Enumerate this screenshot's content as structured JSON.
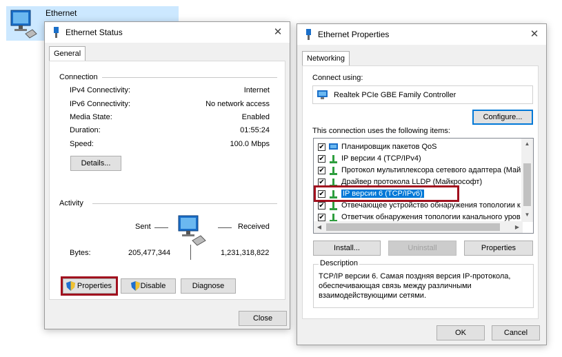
{
  "background": {
    "item_label": "Ethernet"
  },
  "status_window": {
    "title": "Ethernet Status",
    "tab": "General",
    "connection_label": "Connection",
    "rows": [
      {
        "label": "IPv4 Connectivity:",
        "value": "Internet"
      },
      {
        "label": "IPv6 Connectivity:",
        "value": "No network access"
      },
      {
        "label": "Media State:",
        "value": "Enabled"
      },
      {
        "label": "Duration:",
        "value": "01:55:24"
      },
      {
        "label": "Speed:",
        "value": "100.0 Mbps"
      }
    ],
    "details_button": "Details...",
    "activity_label": "Activity",
    "sent_label": "Sent",
    "received_label": "Received",
    "bytes_label": "Bytes:",
    "bytes_sent": "205,477,344",
    "bytes_received": "1,231,318,822",
    "properties_button": "Properties",
    "disable_button": "Disable",
    "diagnose_button": "Diagnose",
    "close_button": "Close"
  },
  "properties_window": {
    "title": "Ethernet Properties",
    "tab": "Networking",
    "connect_using_label": "Connect using:",
    "adapter_name": "Realtek PCIe GBE Family Controller",
    "configure_button": "Configure...",
    "items_label": "This connection uses the following items:",
    "items": [
      {
        "label": "Планировщик пакетов QoS",
        "checked": true,
        "icon": "qos-icon"
      },
      {
        "label": "IP версии 4 (TCP/IPv4)",
        "checked": true,
        "icon": "protocol-icon"
      },
      {
        "label": "Протокол мультиплексора сетевого адаптера (Май",
        "checked": true,
        "icon": "protocol-icon"
      },
      {
        "label": "Драйвер протокола LLDP (Майкрософт)",
        "checked": true,
        "icon": "protocol-icon"
      },
      {
        "label": "IP версии 6 (TCP/IPv6)",
        "checked": true,
        "icon": "protocol-icon",
        "selected": true
      },
      {
        "label": "Отвечающее устройство обнаружения топологии к",
        "checked": true,
        "icon": "protocol-icon"
      },
      {
        "label": "Ответчик обнаружения топологии канального уров",
        "checked": true,
        "icon": "protocol-icon"
      }
    ],
    "install_button": "Install...",
    "uninstall_button": "Uninstall",
    "properties_button": "Properties",
    "description_label": "Description",
    "description_text": "TCP/IP версии 6. Самая поздняя версия IP-протокола, обеспечивающая связь между различными взаимодействующими сетями.",
    "ok_button": "OK",
    "cancel_button": "Cancel"
  },
  "colors": {
    "highlight": "#a1101e",
    "selection": "#0078d7",
    "window_bg": "#f0f0f0"
  }
}
